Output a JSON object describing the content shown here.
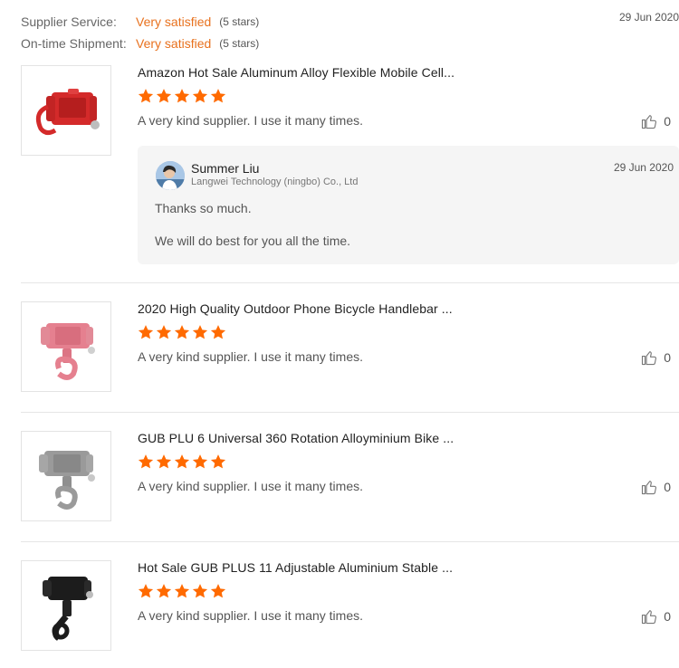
{
  "summary": {
    "supplier_service": {
      "label": "Supplier Service:",
      "value": "Very satisfied",
      "stars": "(5 stars)"
    },
    "on_time_shipment": {
      "label": "On-time Shipment:",
      "value": "Very satisfied",
      "stars": "(5 stars)"
    },
    "date": "29 Jun 2020"
  },
  "reviews": [
    {
      "title": "Amazon Hot Sale Aluminum Alloy Flexible Mobile Cell...",
      "rating": 5,
      "comment": "A very kind supplier. I use it many times.",
      "likes": "0",
      "image_icon": "red-phone-holder-image",
      "reply": {
        "name": "Summer Liu",
        "company": "Langwei Technology (ningbo) Co., Ltd",
        "date": "29 Jun 2020",
        "text1": "Thanks so much.",
        "text2": "We will do best for you all the time."
      }
    },
    {
      "title": "2020 High Quality Outdoor Phone Bicycle Handlebar ...",
      "rating": 5,
      "comment": "A very kind supplier. I use it many times.",
      "likes": "0",
      "image_icon": "pink-phone-holder-image"
    },
    {
      "title": "GUB PLU 6 Universal 360 Rotation Alloyminium Bike ...",
      "rating": 5,
      "comment": "A very kind supplier. I use it many times.",
      "likes": "0",
      "image_icon": "silver-phone-holder-image"
    },
    {
      "title": "Hot Sale GUB PLUS 11 Adjustable Aluminium Stable ...",
      "rating": 5,
      "comment": "A very kind supplier. I use it many times.",
      "likes": "0",
      "image_icon": "black-phone-holder-image"
    }
  ],
  "colors": {
    "accent_orange": "#e8711e",
    "star_orange": "#ff6a00",
    "red_holder": "#d42a2a",
    "pink_holder": "#e5808f",
    "silver_holder": "#9a9a9a",
    "black_holder": "#1c1c1c"
  }
}
